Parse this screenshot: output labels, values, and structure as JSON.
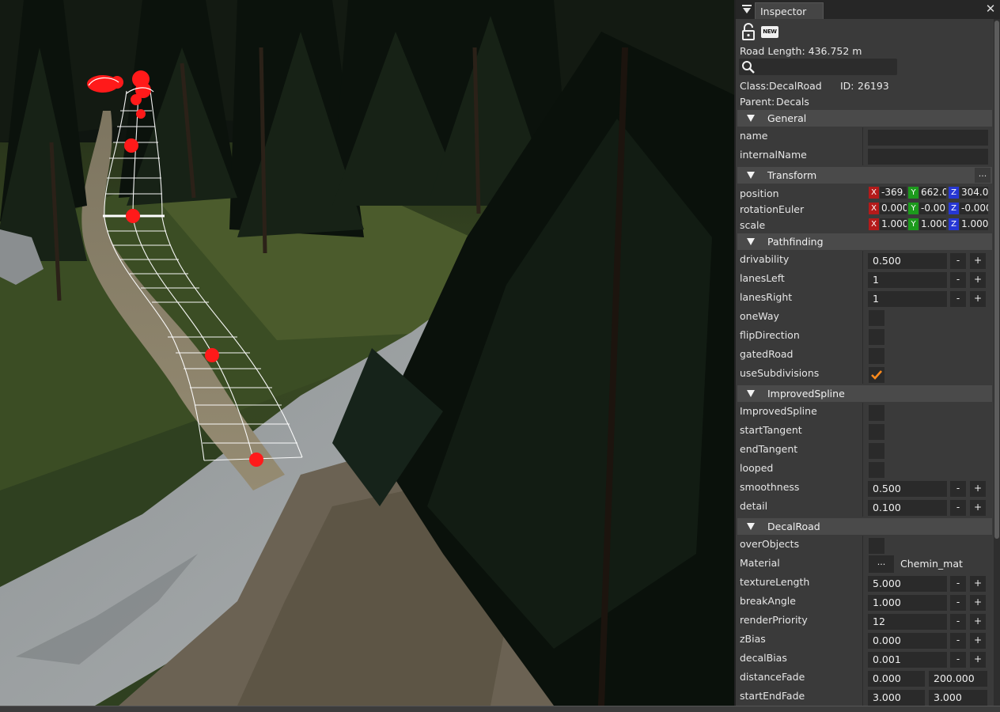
{
  "inspector": {
    "tab_label": "Inspector",
    "new_badge": "NEW",
    "road_length": "Road Length: 436.752 m",
    "search_placeholder": "",
    "class_label": "Class:",
    "class_value": "DecalRoad",
    "id_label": "ID:",
    "id_value": "26193",
    "parent_label": "Parent:",
    "parent_value": "Decals",
    "sections": {
      "general": "General",
      "transform": "Transform",
      "pathfinding": "Pathfinding",
      "improvedspline": "ImprovedSpline",
      "decalroad": "DecalRoad"
    },
    "more_button": "...",
    "general": {
      "name": {
        "label": "name",
        "value": ""
      },
      "internalName": {
        "label": "internalName",
        "value": ""
      }
    },
    "transform": {
      "axis_x": "X",
      "axis_y": "Y",
      "axis_z": "Z",
      "position": {
        "label": "position",
        "x": "-369.",
        "y": "662.0",
        "z": "304.0"
      },
      "rotationEuler": {
        "label": "rotationEuler",
        "x": "0.000",
        "y": "-0.00",
        "z": "-0.000"
      },
      "scale": {
        "label": "scale",
        "x": "1.000",
        "y": "1.000",
        "z": "1.000"
      }
    },
    "stepper_minus": "-",
    "stepper_plus": "+",
    "pathfinding": {
      "drivability": {
        "label": "drivability",
        "value": "0.500"
      },
      "lanesLeft": {
        "label": "lanesLeft",
        "value": "1"
      },
      "lanesRight": {
        "label": "lanesRight",
        "value": "1"
      },
      "oneWay": {
        "label": "oneWay",
        "checked": false
      },
      "flipDirection": {
        "label": "flipDirection",
        "checked": false
      },
      "gatedRoad": {
        "label": "gatedRoad",
        "checked": false
      },
      "useSubdivisions": {
        "label": "useSubdivisions",
        "checked": true
      }
    },
    "improvedspline": {
      "ImprovedSpline": {
        "label": "ImprovedSpline",
        "checked": false
      },
      "startTangent": {
        "label": "startTangent",
        "checked": false
      },
      "endTangent": {
        "label": "endTangent",
        "checked": false
      },
      "looped": {
        "label": "looped",
        "checked": false
      },
      "smoothness": {
        "label": "smoothness",
        "value": "0.500"
      },
      "detail": {
        "label": "detail",
        "value": "0.100"
      }
    },
    "decalroad": {
      "overObjects": {
        "label": "overObjects",
        "checked": false
      },
      "Material": {
        "label": "Material",
        "button": "...",
        "value": "Chemin_mat"
      },
      "textureLength": {
        "label": "textureLength",
        "value": "5.000"
      },
      "breakAngle": {
        "label": "breakAngle",
        "value": "1.000"
      },
      "renderPriority": {
        "label": "renderPriority",
        "value": "12"
      },
      "zBias": {
        "label": "zBias",
        "value": "0.000"
      },
      "decalBias": {
        "label": "decalBias",
        "value": "0.001"
      },
      "distanceFade": {
        "label": "distanceFade",
        "value1": "0.000",
        "value2": "200.000"
      },
      "startEndFade": {
        "label": "startEndFade",
        "value1": "3.000",
        "value2": "3.000"
      }
    }
  },
  "colors": {
    "spline_node": "#ff1a1a",
    "spline_mesh": "#ffffff",
    "checkmark": "#ff8a1c",
    "axis_x": "#b41a1a",
    "axis_y": "#1c9a1c",
    "axis_z": "#2637d4"
  },
  "icons": [
    "menu-triangle-icon",
    "lock-icon",
    "new-icon",
    "search-icon",
    "close-icon",
    "checkmark-icon"
  ]
}
